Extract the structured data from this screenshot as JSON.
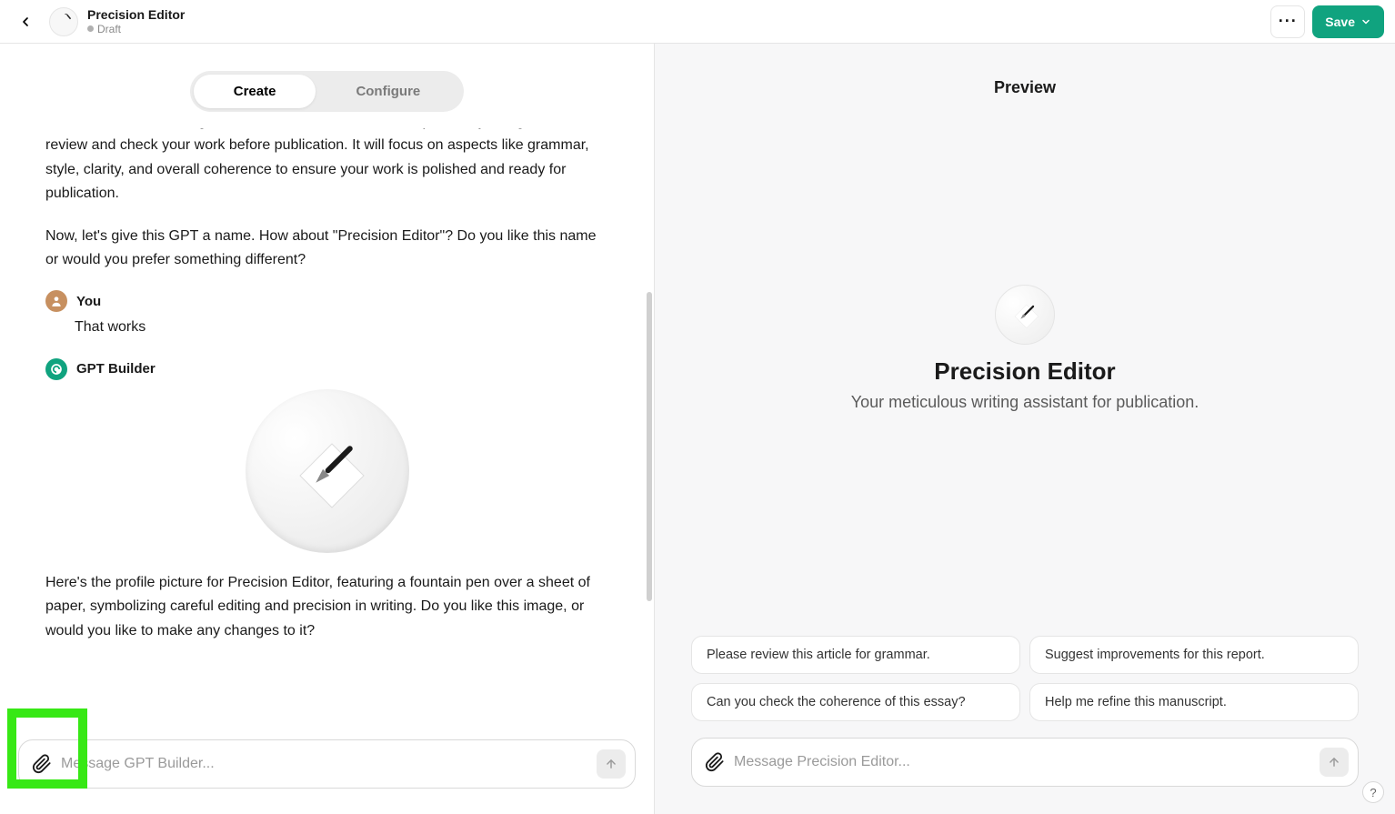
{
  "header": {
    "title": "Precision Editor",
    "status": "Draft",
    "menu_label": "···",
    "save_label": "Save"
  },
  "tabs": {
    "create": "Create",
    "configure": "Configure",
    "active": "create"
  },
  "chat": {
    "builder_para1": "Great! So, we're creating a GPT that will act as an editor, specifically designed to review and check your work before publication. It will focus on aspects like grammar, style, clarity, and overall coherence to ensure your work is polished and ready for publication.",
    "builder_para2": "Now, let's give this GPT a name. How about \"Precision Editor\"? Do you like this name or would you prefer something different?",
    "you_name": "You",
    "user_reply": "That works",
    "builder_name": "GPT Builder",
    "builder_profile_msg": "Here's the profile picture for Precision Editor, featuring a fountain pen over a sheet of paper, symbolizing careful editing and precision in writing. Do you like this image, or would you like to make any changes to it?"
  },
  "composer": {
    "placeholder": "Message GPT Builder..."
  },
  "preview": {
    "heading": "Preview",
    "name": "Precision Editor",
    "description": "Your meticulous writing assistant for publication.",
    "suggestions": [
      "Please review this article for grammar.",
      "Suggest improvements for this report.",
      "Can you check the coherence of this essay?",
      "Help me refine this manuscript."
    ],
    "composer_placeholder": "Message Precision Editor..."
  },
  "help_label": "?"
}
